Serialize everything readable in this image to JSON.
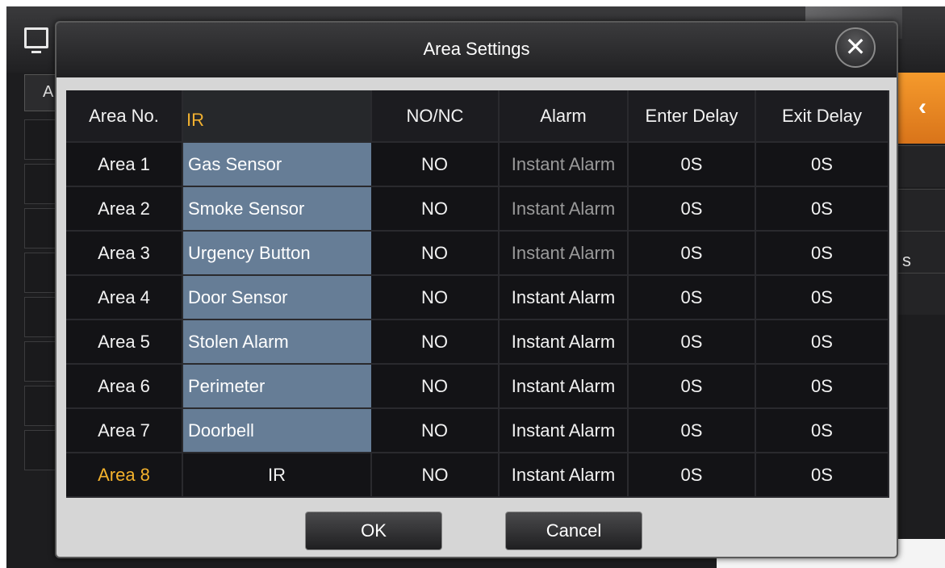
{
  "background": {
    "left_tab_label": "A",
    "right_side_text": "s",
    "back_chevron": "‹"
  },
  "dialog": {
    "title": "Area Settings",
    "close_glyph": "✕",
    "columns": [
      "Area No.",
      "IR",
      "NO/NC",
      "Alarm",
      "Enter Delay",
      "Exit Delay"
    ],
    "rows": [
      {
        "area": "Area 1",
        "type": "Gas Sensor",
        "nonc": "NO",
        "alarm": "Instant Alarm",
        "enter": "0S",
        "exit": "0S"
      },
      {
        "area": "Area 2",
        "type": "Smoke Sensor",
        "nonc": "NO",
        "alarm": "Instant Alarm",
        "enter": "0S",
        "exit": "0S"
      },
      {
        "area": "Area 3",
        "type": "Urgency Button",
        "nonc": "NO",
        "alarm": "Instant Alarm",
        "enter": "0S",
        "exit": "0S"
      },
      {
        "area": "Area 4",
        "type": "Door Sensor",
        "nonc": "NO",
        "alarm": "Instant Alarm",
        "enter": "0S",
        "exit": "0S"
      },
      {
        "area": "Area 5",
        "type": "Stolen Alarm",
        "nonc": "NO",
        "alarm": "Instant Alarm",
        "enter": "0S",
        "exit": "0S"
      },
      {
        "area": "Area 6",
        "type": "Perimeter",
        "nonc": "NO",
        "alarm": "Instant Alarm",
        "enter": "0S",
        "exit": "0S"
      },
      {
        "area": "Area 7",
        "type": "Doorbell",
        "nonc": "NO",
        "alarm": "Instant Alarm",
        "enter": "0S",
        "exit": "0S"
      },
      {
        "area": "Area 8",
        "type": "IR",
        "nonc": "NO",
        "alarm": "Instant Alarm",
        "enter": "0S",
        "exit": "0S"
      }
    ],
    "ok_label": "OK",
    "cancel_label": "Cancel"
  },
  "colors": {
    "highlight": "#f4b22c",
    "dropdown_bg": "#667d96",
    "accent_orange": "#f08c20"
  },
  "icons": [
    "monitor-icon",
    "close-icon",
    "chevron-left-icon"
  ]
}
